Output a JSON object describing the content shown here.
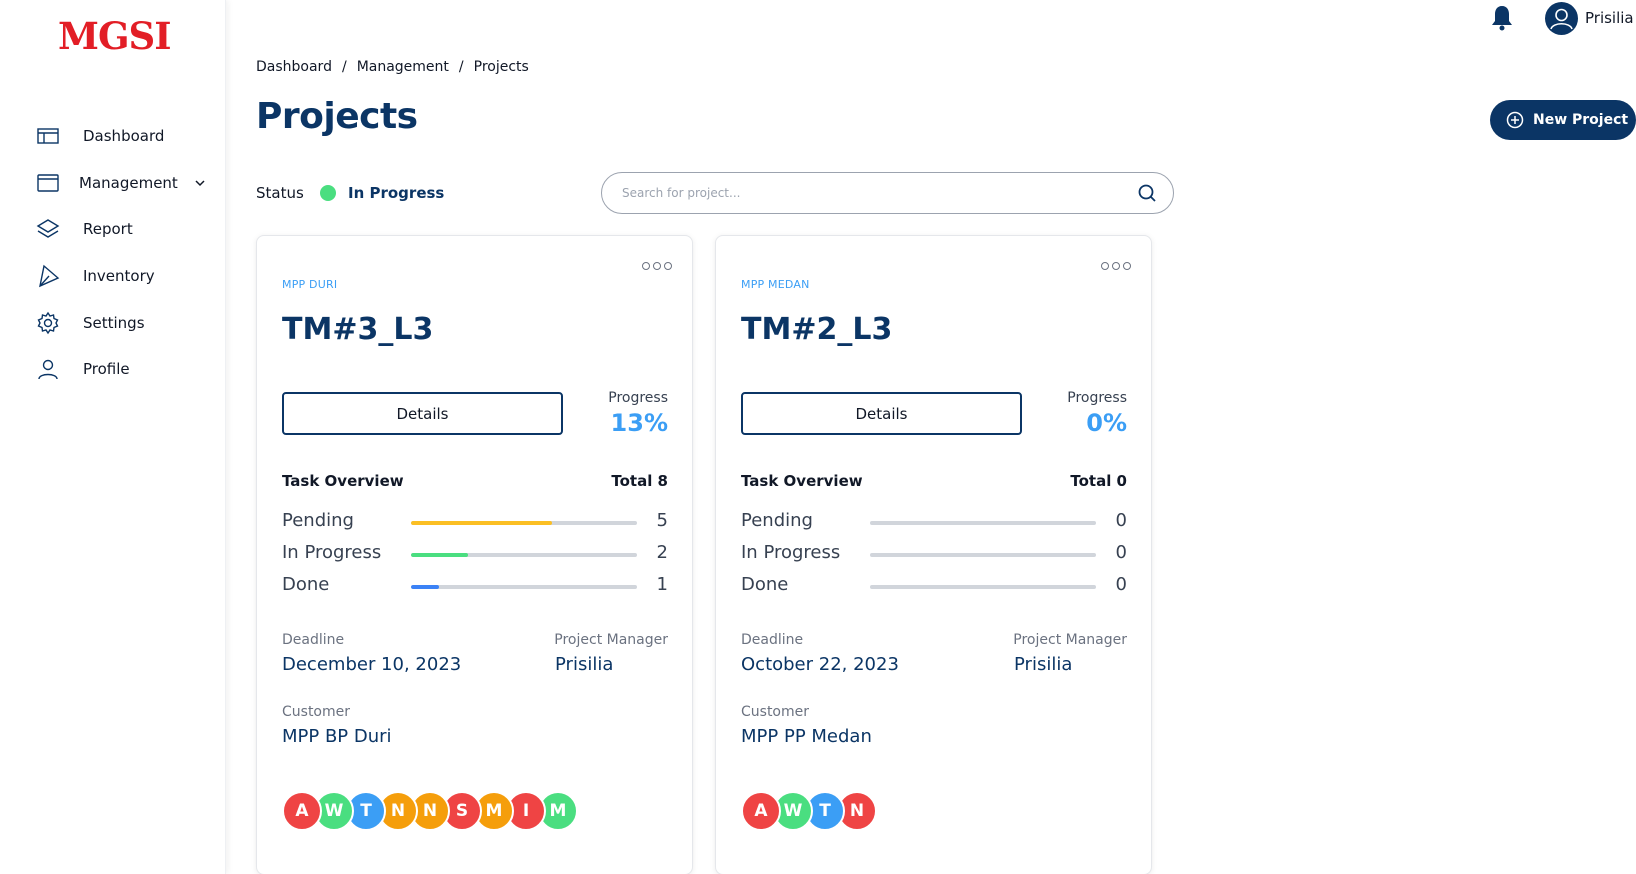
{
  "app": {
    "logo_text": "MGSI"
  },
  "sidebar": {
    "items": [
      {
        "label": "Dashboard",
        "icon": "table-icon"
      },
      {
        "label": "Management",
        "icon": "window-icon",
        "has_dropdown": true
      },
      {
        "label": "Report",
        "icon": "layers-icon"
      },
      {
        "label": "Inventory",
        "icon": "send-icon"
      },
      {
        "label": "Settings",
        "icon": "gear-icon"
      },
      {
        "label": "Profile",
        "icon": "user-icon"
      }
    ]
  },
  "topbar": {
    "user_name": "Prisilia"
  },
  "breadcrumb": [
    "Dashboard",
    "Management",
    "Projects"
  ],
  "page": {
    "title": "Projects",
    "new_project_label": "New Project"
  },
  "filter": {
    "status_label": "Status",
    "status_value": "In Progress",
    "status_color": "#4ade80"
  },
  "search": {
    "placeholder": "Search for project..."
  },
  "colors": {
    "primary": "#0b3565",
    "accent": "#3b9ef5",
    "pending": "#fbbf24",
    "in_progress": "#4ade80",
    "done": "#3b82f6",
    "logo": "#e21e26"
  },
  "projects": [
    {
      "location": "MPP DURI",
      "code": "TM#3_L3",
      "details_label": "Details",
      "progress_label": "Progress",
      "progress": "13%",
      "overview_title": "Task Overview",
      "total": "Total 8",
      "tasks": [
        {
          "label": "Pending",
          "count": "5",
          "fraction": 0.625
        },
        {
          "label": "In Progress",
          "count": "2",
          "fraction": 0.25
        },
        {
          "label": "Done",
          "count": "1",
          "fraction": 0.125
        }
      ],
      "deadline_label": "Deadline",
      "deadline": "December 10, 2023",
      "pm_label": "Project Manager",
      "pm": "Prisilia",
      "customer_label": "Customer",
      "customer": "MPP BP Duri",
      "members": [
        {
          "initial": "A",
          "color": "red"
        },
        {
          "initial": "W",
          "color": "green"
        },
        {
          "initial": "T",
          "color": "blue"
        },
        {
          "initial": "N",
          "color": "orange"
        },
        {
          "initial": "N",
          "color": "orange"
        },
        {
          "initial": "S",
          "color": "red"
        },
        {
          "initial": "M",
          "color": "orange"
        },
        {
          "initial": "I",
          "color": "red"
        },
        {
          "initial": "M",
          "color": "green"
        }
      ]
    },
    {
      "location": "MPP MEDAN",
      "code": "TM#2_L3",
      "details_label": "Details",
      "progress_label": "Progress",
      "progress": "0%",
      "overview_title": "Task Overview",
      "total": "Total 0",
      "tasks": [
        {
          "label": "Pending",
          "count": "0",
          "fraction": 0
        },
        {
          "label": "In Progress",
          "count": "0",
          "fraction": 0
        },
        {
          "label": "Done",
          "count": "0",
          "fraction": 0
        }
      ],
      "deadline_label": "Deadline",
      "deadline": "October 22, 2023",
      "pm_label": "Project Manager",
      "pm": "Prisilia",
      "customer_label": "Customer",
      "customer": "MPP PP Medan",
      "members": [
        {
          "initial": "A",
          "color": "red"
        },
        {
          "initial": "W",
          "color": "green"
        },
        {
          "initial": "T",
          "color": "blue"
        },
        {
          "initial": "N",
          "color": "red"
        }
      ]
    }
  ]
}
